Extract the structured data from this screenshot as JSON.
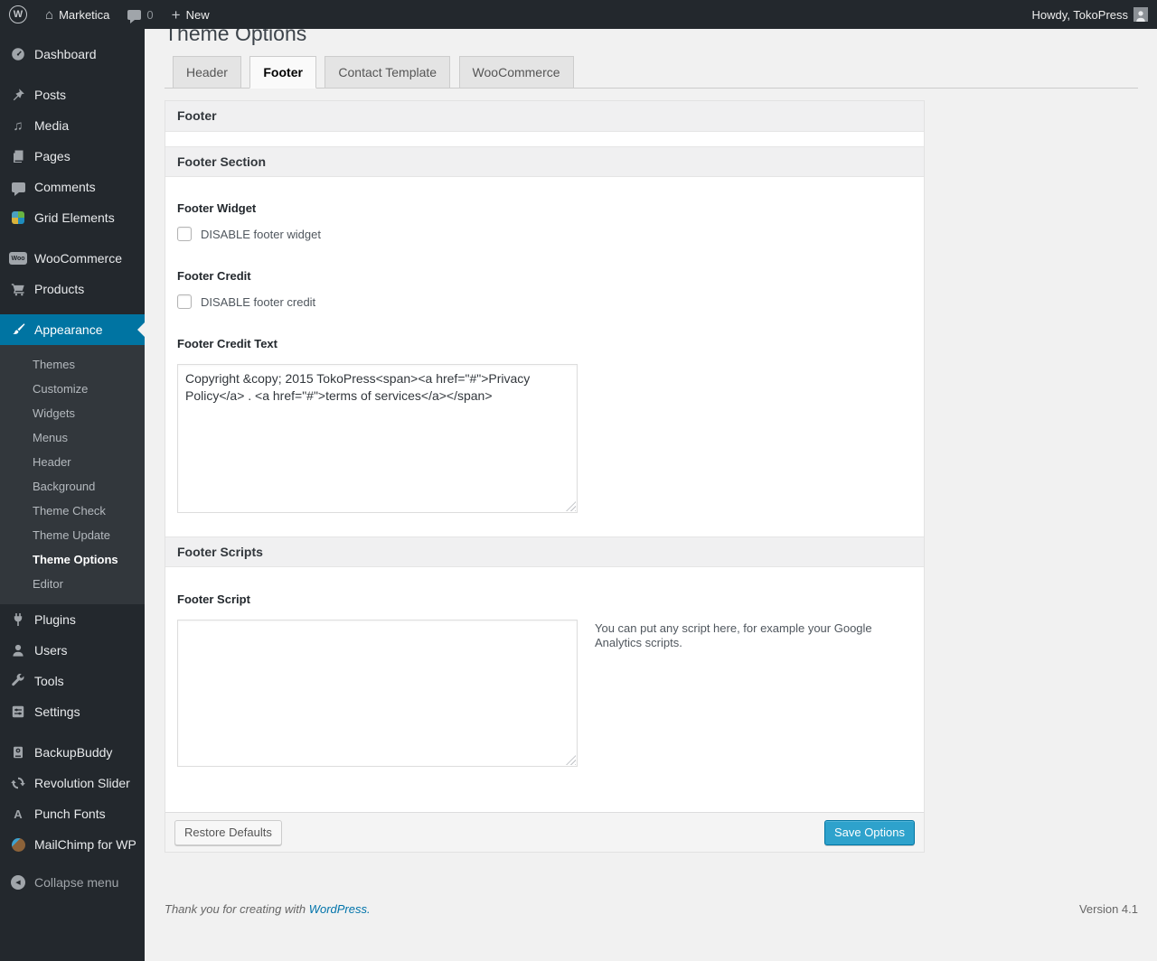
{
  "admin_bar": {
    "site_name": "Marketica",
    "comment_count": "0",
    "new_label": "New",
    "howdy": "Howdy, TokoPress"
  },
  "sidebar": {
    "top_items": [
      "Dashboard",
      "Posts",
      "Media",
      "Pages",
      "Comments",
      "Grid Elements"
    ],
    "commerce_items": [
      "WooCommerce",
      "Products"
    ],
    "appearance": {
      "label": "Appearance",
      "submenu": [
        "Themes",
        "Customize",
        "Widgets",
        "Menus",
        "Header",
        "Background",
        "Theme Check",
        "Theme Update",
        "Theme Options",
        "Editor"
      ],
      "current_item": "Theme Options"
    },
    "tool_items": [
      "Plugins",
      "Users",
      "Tools",
      "Settings"
    ],
    "plugin_items": [
      "BackupBuddy",
      "Revolution Slider",
      "Punch Fonts",
      "MailChimp for WP"
    ],
    "collapse_label": "Collapse menu"
  },
  "page": {
    "title": "Theme Options",
    "tabs": [
      {
        "label": "Header"
      },
      {
        "label": "Footer"
      },
      {
        "label": "Contact Template"
      },
      {
        "label": "WooCommerce"
      }
    ],
    "active_tab": "Footer",
    "panel": {
      "header_title": "Footer",
      "section_title": "Footer Section",
      "footer_widget_label": "Footer Widget",
      "footer_widget_checkbox_label": "DISABLE footer widget",
      "footer_credit_label": "Footer Credit",
      "footer_credit_checkbox_label": "DISABLE footer credit",
      "footer_credit_text_label": "Footer Credit Text",
      "footer_credit_text_value": "Copyright &copy; 2015 TokoPress<span><a href=\"#\">Privacy Policy</a> . <a href=\"#\">terms of services</a></span>",
      "scripts_section_title": "Footer Scripts",
      "footer_script_label": "Footer Script",
      "footer_script_value": "",
      "footer_script_help": "You can put any script here, for example your Google Analytics scripts.",
      "restore_button_label": "Restore Defaults",
      "save_button_label": "Save Options"
    },
    "footer": {
      "thanks_prefix": "Thank you for creating with",
      "wordpress_link": "WordPress.",
      "version": "Version 4.1"
    }
  },
  "icons": {
    "wp-logo-icon": "W in circle",
    "home-icon": "house",
    "comments-bubble-icon": "speech bubble",
    "plus-icon": "+",
    "collapse-icon": "left arrow in circle"
  },
  "colors": {
    "admin_bar_bg": "#23282d",
    "menu_active_bg": "#0074a2",
    "submenu_bg": "#32373c",
    "content_bg": "#f1f1f1",
    "primary_button_bg": "#2ea2cc",
    "primary_button_border": "#0074a2",
    "link_blue": "#0073aa"
  }
}
